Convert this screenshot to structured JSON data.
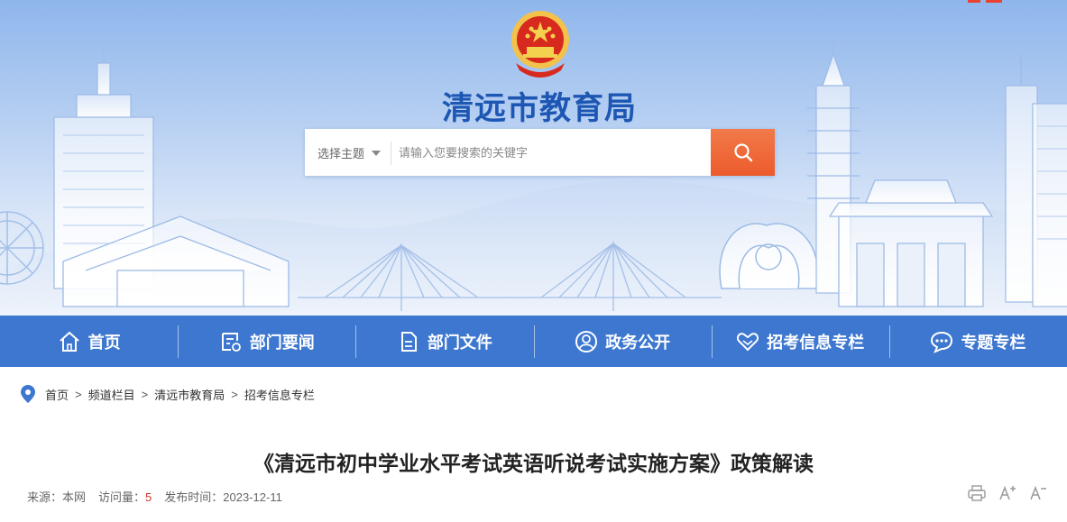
{
  "header": {
    "site_title": "清远市教育局",
    "search": {
      "topic_label": "选择主题",
      "placeholder": "请输入您要搜索的关键字",
      "icon": "search-icon"
    }
  },
  "nav": {
    "items": [
      {
        "label": "首页",
        "icon": "home-icon"
      },
      {
        "label": "部门要闻",
        "icon": "news-icon"
      },
      {
        "label": "部门文件",
        "icon": "document-icon"
      },
      {
        "label": "政务公开",
        "icon": "user-icon"
      },
      {
        "label": "招考信息专栏",
        "icon": "heart-hands-icon"
      },
      {
        "label": "专题专栏",
        "icon": "chat-icon"
      }
    ]
  },
  "breadcrumb": {
    "icon": "location-pin-icon",
    "items": [
      "首页",
      "频道栏目",
      "清远市教育局",
      "招考信息专栏"
    ],
    "separator": ">"
  },
  "article": {
    "title": "《清远市初中学业水平考试英语听说考试实施方案》政策解读",
    "source_label": "来源：",
    "source_value": "本网",
    "views_label": "访问量：",
    "views_value": "5",
    "date_label": "发布时间：",
    "date_value": "2023-12-11"
  },
  "tools": {
    "print_icon": "print-icon",
    "font_increase_label": "A+",
    "font_decrease_label": "A-"
  },
  "colors": {
    "nav_bg": "#3d77cf",
    "title_blue": "#1d57b3",
    "search_button": "#ec5b2c",
    "views_number": "#d2332a"
  }
}
